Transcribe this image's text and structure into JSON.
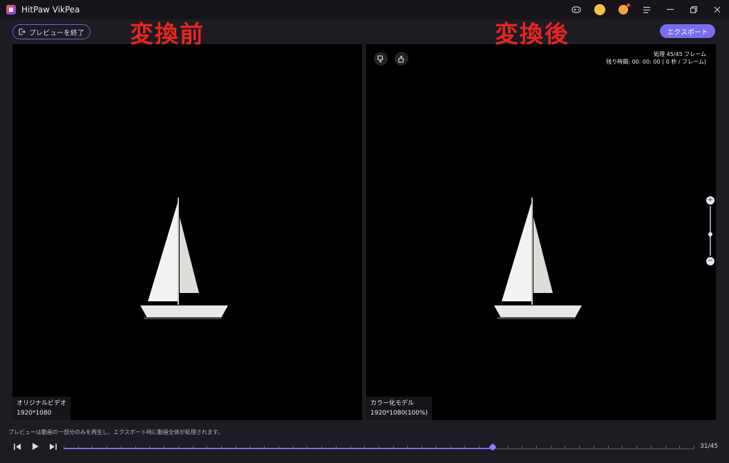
{
  "window": {
    "title": "HitPaw VikPea"
  },
  "toolbar": {
    "end_preview_label": "プレビューを終了",
    "export_label": "エクスポート"
  },
  "overlay": {
    "before": "変換前",
    "after": "変換後"
  },
  "left_panel": {
    "name": "オリジナルビデオ",
    "resolution": "1920*1080"
  },
  "right_panel": {
    "name": "カラー化モデル",
    "resolution": "1920*1080(100%)",
    "processed": "処理 45/45 フレーム",
    "remaining": "残り時間: 00: 00: 00 ( 0 秒 / フレーム)"
  },
  "footer": {
    "hint": "プレビューは動画の一部分のみを再生し、エクスポート時に動画全体が処理されます。",
    "frame_count": "31/45",
    "progress": 0.68,
    "tick_count": 45
  },
  "icons": {
    "logo": "app-logo-icon",
    "game": "gamepad-icon",
    "gift": "gift-icon",
    "user": "user-icon",
    "menu": "menu-icon",
    "minimize": "minimize-icon",
    "restore": "restore-icon",
    "close": "close-icon",
    "exit": "exit-icon",
    "dislike": "thumbs-down-icon",
    "like": "thumbs-up-icon",
    "zoom_in": "zoom-in-icon",
    "zoom_out": "zoom-out-icon",
    "prev": "previous-frame-icon",
    "play": "play-icon",
    "next": "next-frame-icon"
  },
  "colors": {
    "accent": "#7a6cf2",
    "overlay_text": "#e8261c",
    "background": "#1c1c22"
  }
}
